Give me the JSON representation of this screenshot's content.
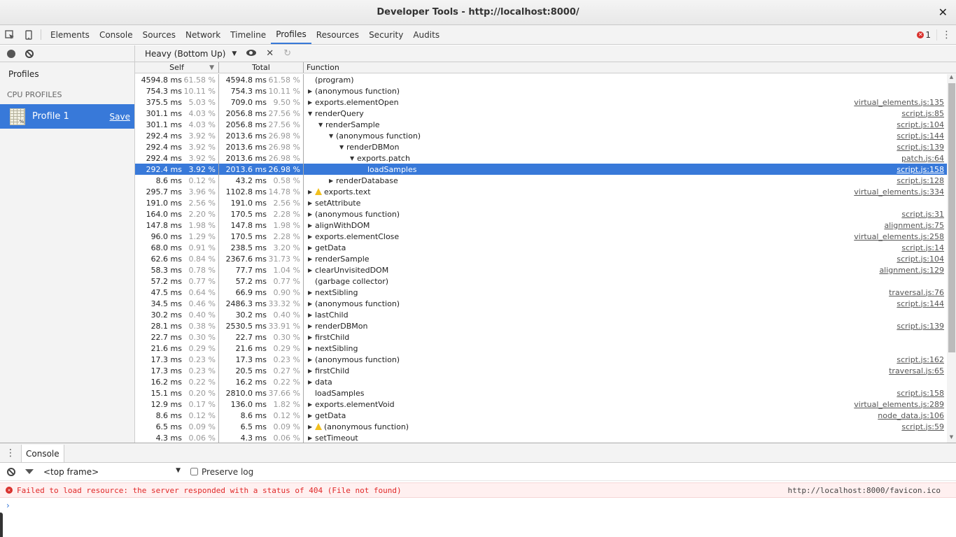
{
  "window": {
    "title": "Developer Tools - http://localhost:8000/",
    "close_glyph": "✕"
  },
  "toolbar": {
    "tabs": [
      {
        "label": "Elements",
        "active": false
      },
      {
        "label": "Console",
        "active": false
      },
      {
        "label": "Sources",
        "active": false
      },
      {
        "label": "Network",
        "active": false
      },
      {
        "label": "Timeline",
        "active": false
      },
      {
        "label": "Profiles",
        "active": true
      },
      {
        "label": "Resources",
        "active": false
      },
      {
        "label": "Security",
        "active": false
      },
      {
        "label": "Audits",
        "active": false
      }
    ],
    "error_count": "1",
    "inspect_icon": "inspect-element-icon",
    "device_icon": "device-mode-icon",
    "menu_icon": "more-vertical-icon"
  },
  "sidebar": {
    "heading": "Profiles",
    "section": "CPU PROFILES",
    "profile": {
      "name": "Profile 1",
      "save_label": "Save"
    }
  },
  "profile_view": {
    "view_mode": "Heavy (Bottom Up)",
    "columns": {
      "self": "Self",
      "total": "Total",
      "function": "Function"
    },
    "rows": [
      {
        "self_ms": "4594.8 ms",
        "self_pct": "61.58 %",
        "total_ms": "4594.8 ms",
        "total_pct": "61.58 %",
        "depth": 0,
        "arrow": "none",
        "warn": false,
        "name": "(program)",
        "url": ""
      },
      {
        "self_ms": "754.3 ms",
        "self_pct": "10.11 %",
        "total_ms": "754.3 ms",
        "total_pct": "10.11 %",
        "depth": 0,
        "arrow": "right",
        "warn": false,
        "name": "(anonymous function)",
        "url": ""
      },
      {
        "self_ms": "375.5 ms",
        "self_pct": "5.03 %",
        "total_ms": "709.0 ms",
        "total_pct": "9.50 %",
        "depth": 0,
        "arrow": "right",
        "warn": false,
        "name": "exports.elementOpen",
        "url": "virtual_elements.js:135"
      },
      {
        "self_ms": "301.1 ms",
        "self_pct": "4.03 %",
        "total_ms": "2056.8 ms",
        "total_pct": "27.56 %",
        "depth": 0,
        "arrow": "down",
        "warn": false,
        "name": "renderQuery",
        "url": "script.js:85"
      },
      {
        "self_ms": "301.1 ms",
        "self_pct": "4.03 %",
        "total_ms": "2056.8 ms",
        "total_pct": "27.56 %",
        "depth": 1,
        "arrow": "down",
        "warn": false,
        "name": "renderSample",
        "url": "script.js:104"
      },
      {
        "self_ms": "292.4 ms",
        "self_pct": "3.92 %",
        "total_ms": "2013.6 ms",
        "total_pct": "26.98 %",
        "depth": 2,
        "arrow": "down",
        "warn": false,
        "name": "(anonymous function)",
        "url": "script.js:144"
      },
      {
        "self_ms": "292.4 ms",
        "self_pct": "3.92 %",
        "total_ms": "2013.6 ms",
        "total_pct": "26.98 %",
        "depth": 3,
        "arrow": "down",
        "warn": false,
        "name": "renderDBMon",
        "url": "script.js:139"
      },
      {
        "self_ms": "292.4 ms",
        "self_pct": "3.92 %",
        "total_ms": "2013.6 ms",
        "total_pct": "26.98 %",
        "depth": 4,
        "arrow": "down",
        "warn": false,
        "name": "exports.patch",
        "url": "patch.js:64"
      },
      {
        "self_ms": "292.4 ms",
        "self_pct": "3.92 %",
        "total_ms": "2013.6 ms",
        "total_pct": "26.98 %",
        "depth": 5,
        "arrow": "none",
        "warn": false,
        "name": "loadSamples",
        "url": "script.js:158",
        "selected": true
      },
      {
        "self_ms": "8.6 ms",
        "self_pct": "0.12 %",
        "total_ms": "43.2 ms",
        "total_pct": "0.58 %",
        "depth": 2,
        "arrow": "right",
        "warn": false,
        "name": "renderDatabase",
        "url": "script.js:128"
      },
      {
        "self_ms": "295.7 ms",
        "self_pct": "3.96 %",
        "total_ms": "1102.8 ms",
        "total_pct": "14.78 %",
        "depth": 0,
        "arrow": "right",
        "warn": true,
        "name": "exports.text",
        "url": "virtual_elements.js:334"
      },
      {
        "self_ms": "191.0 ms",
        "self_pct": "2.56 %",
        "total_ms": "191.0 ms",
        "total_pct": "2.56 %",
        "depth": 0,
        "arrow": "right",
        "warn": false,
        "name": "setAttribute",
        "url": ""
      },
      {
        "self_ms": "164.0 ms",
        "self_pct": "2.20 %",
        "total_ms": "170.5 ms",
        "total_pct": "2.28 %",
        "depth": 0,
        "arrow": "right",
        "warn": false,
        "name": "(anonymous function)",
        "url": "script.js:31"
      },
      {
        "self_ms": "147.8 ms",
        "self_pct": "1.98 %",
        "total_ms": "147.8 ms",
        "total_pct": "1.98 %",
        "depth": 0,
        "arrow": "right",
        "warn": false,
        "name": "alignWithDOM",
        "url": "alignment.js:75"
      },
      {
        "self_ms": "96.0 ms",
        "self_pct": "1.29 %",
        "total_ms": "170.5 ms",
        "total_pct": "2.28 %",
        "depth": 0,
        "arrow": "right",
        "warn": false,
        "name": "exports.elementClose",
        "url": "virtual_elements.js:258"
      },
      {
        "self_ms": "68.0 ms",
        "self_pct": "0.91 %",
        "total_ms": "238.5 ms",
        "total_pct": "3.20 %",
        "depth": 0,
        "arrow": "right",
        "warn": false,
        "name": "getData",
        "url": "script.js:14"
      },
      {
        "self_ms": "62.6 ms",
        "self_pct": "0.84 %",
        "total_ms": "2367.6 ms",
        "total_pct": "31.73 %",
        "depth": 0,
        "arrow": "right",
        "warn": false,
        "name": "renderSample",
        "url": "script.js:104"
      },
      {
        "self_ms": "58.3 ms",
        "self_pct": "0.78 %",
        "total_ms": "77.7 ms",
        "total_pct": "1.04 %",
        "depth": 0,
        "arrow": "right",
        "warn": false,
        "name": "clearUnvisitedDOM",
        "url": "alignment.js:129"
      },
      {
        "self_ms": "57.2 ms",
        "self_pct": "0.77 %",
        "total_ms": "57.2 ms",
        "total_pct": "0.77 %",
        "depth": 0,
        "arrow": "none",
        "warn": false,
        "name": "(garbage collector)",
        "url": ""
      },
      {
        "self_ms": "47.5 ms",
        "self_pct": "0.64 %",
        "total_ms": "66.9 ms",
        "total_pct": "0.90 %",
        "depth": 0,
        "arrow": "right",
        "warn": false,
        "name": "nextSibling",
        "url": "traversal.js:76"
      },
      {
        "self_ms": "34.5 ms",
        "self_pct": "0.46 %",
        "total_ms": "2486.3 ms",
        "total_pct": "33.32 %",
        "depth": 0,
        "arrow": "right",
        "warn": false,
        "name": "(anonymous function)",
        "url": "script.js:144"
      },
      {
        "self_ms": "30.2 ms",
        "self_pct": "0.40 %",
        "total_ms": "30.2 ms",
        "total_pct": "0.40 %",
        "depth": 0,
        "arrow": "right",
        "warn": false,
        "name": "lastChild",
        "url": ""
      },
      {
        "self_ms": "28.1 ms",
        "self_pct": "0.38 %",
        "total_ms": "2530.5 ms",
        "total_pct": "33.91 %",
        "depth": 0,
        "arrow": "right",
        "warn": false,
        "name": "renderDBMon",
        "url": "script.js:139"
      },
      {
        "self_ms": "22.7 ms",
        "self_pct": "0.30 %",
        "total_ms": "22.7 ms",
        "total_pct": "0.30 %",
        "depth": 0,
        "arrow": "right",
        "warn": false,
        "name": "firstChild",
        "url": ""
      },
      {
        "self_ms": "21.6 ms",
        "self_pct": "0.29 %",
        "total_ms": "21.6 ms",
        "total_pct": "0.29 %",
        "depth": 0,
        "arrow": "right",
        "warn": false,
        "name": "nextSibling",
        "url": ""
      },
      {
        "self_ms": "17.3 ms",
        "self_pct": "0.23 %",
        "total_ms": "17.3 ms",
        "total_pct": "0.23 %",
        "depth": 0,
        "arrow": "right",
        "warn": false,
        "name": "(anonymous function)",
        "url": "script.js:162"
      },
      {
        "self_ms": "17.3 ms",
        "self_pct": "0.23 %",
        "total_ms": "20.5 ms",
        "total_pct": "0.27 %",
        "depth": 0,
        "arrow": "right",
        "warn": false,
        "name": "firstChild",
        "url": "traversal.js:65"
      },
      {
        "self_ms": "16.2 ms",
        "self_pct": "0.22 %",
        "total_ms": "16.2 ms",
        "total_pct": "0.22 %",
        "depth": 0,
        "arrow": "right",
        "warn": false,
        "name": "data",
        "url": ""
      },
      {
        "self_ms": "15.1 ms",
        "self_pct": "0.20 %",
        "total_ms": "2810.0 ms",
        "total_pct": "37.66 %",
        "depth": 0,
        "arrow": "none",
        "warn": false,
        "name": "loadSamples",
        "url": "script.js:158"
      },
      {
        "self_ms": "12.9 ms",
        "self_pct": "0.17 %",
        "total_ms": "136.0 ms",
        "total_pct": "1.82 %",
        "depth": 0,
        "arrow": "right",
        "warn": false,
        "name": "exports.elementVoid",
        "url": "virtual_elements.js:289"
      },
      {
        "self_ms": "8.6 ms",
        "self_pct": "0.12 %",
        "total_ms": "8.6 ms",
        "total_pct": "0.12 %",
        "depth": 0,
        "arrow": "right",
        "warn": false,
        "name": "getData",
        "url": "node_data.js:106"
      },
      {
        "self_ms": "6.5 ms",
        "self_pct": "0.09 %",
        "total_ms": "6.5 ms",
        "total_pct": "0.09 %",
        "depth": 0,
        "arrow": "right",
        "warn": true,
        "name": "(anonymous function)",
        "url": "script.js:59"
      },
      {
        "self_ms": "4.3 ms",
        "self_pct": "0.06 %",
        "total_ms": "4.3 ms",
        "total_pct": "0.06 %",
        "depth": 0,
        "arrow": "right",
        "warn": false,
        "name": "setTimeout",
        "url": ""
      }
    ]
  },
  "drawer": {
    "tab_label": "Console",
    "context_select": "<top frame>",
    "preserve_log_label": "Preserve log",
    "preserve_log_checked": false,
    "messages": [
      {
        "level": "error",
        "text": "Failed to load resource: the server responded with a status of 404 (File not found)",
        "source": "http://localhost:8000/favicon.ico"
      }
    ],
    "prompt_glyph": "›"
  },
  "colors": {
    "accent": "#3879d9",
    "error": "#d9302c",
    "warning": "#f2c01e"
  }
}
